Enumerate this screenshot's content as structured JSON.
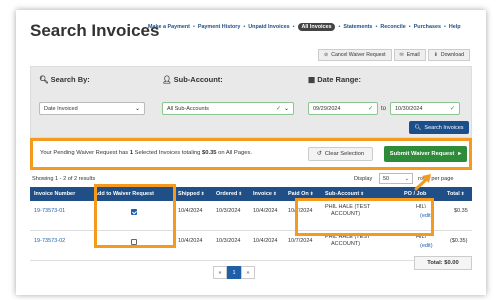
{
  "page": {
    "title": "Search Invoices"
  },
  "nav": {
    "items": [
      "Make a Payment",
      "Payment History",
      "Unpaid Invoices",
      "All Invoices",
      "Statements",
      "Reconcile",
      "Purchases",
      "Help"
    ],
    "active": "All Invoices"
  },
  "actions": {
    "cancel_waiver": "Cancel Waiver Request",
    "email": "Email",
    "download": "Download"
  },
  "filters": {
    "search_by_label": "Search By:",
    "search_by_value": "Date Invoiced",
    "sub_account_label": "Sub-Account:",
    "sub_account_value": "All Sub-Accounts",
    "date_range_label": "Date Range:",
    "date_from": "09/29/2024",
    "to_label": "to",
    "date_to": "10/30/2024",
    "search_button": "Search Invoices"
  },
  "pending": {
    "prefix": "Your Pending Waiver Request has ",
    "count": "1",
    "middle": " Selected Invoices totaling ",
    "amount": "$0.35",
    "suffix": " on All Pages.",
    "clear_button": "Clear Selection",
    "submit_button": "Submit Waiver Request"
  },
  "results": {
    "summary": "Showing 1 - 2 of 2 results",
    "display_label": "Display",
    "display_value": "50",
    "rows_per_page": "rows per page"
  },
  "table": {
    "headers": {
      "invoice_number": "Invoice Number",
      "add_to_waiver": "Add to Waiver Request",
      "shipped": "Shipped",
      "ordered": "Ordered",
      "invoice": "Invoice",
      "paid_on": "Paid On",
      "sub_account": "Sub-Account",
      "po_job": "PO / Job",
      "total": "Total"
    },
    "rows": [
      {
        "invoice_number": "19-73573-01",
        "checked": true,
        "shipped": "10/4/2024",
        "ordered": "10/3/2024",
        "invoice": "10/4/2024",
        "paid_on": "10/7/2024",
        "sub_account_1": "PHIL HALE (TEST",
        "sub_account_2": "ACCOUNT)",
        "po": "HIL\\",
        "edit": "(edit)",
        "total": "$0.35"
      },
      {
        "invoice_number": "19-73573-02",
        "checked": false,
        "shipped": "10/4/2024",
        "ordered": "10/3/2024",
        "invoice": "10/4/2024",
        "paid_on": "10/7/2024",
        "sub_account_1": "PHIL HALE (TEST",
        "sub_account_2": "ACCOUNT)",
        "po": "HIL\\",
        "edit": "(edit)",
        "total": "($0.35)"
      }
    ],
    "total_label": "Total: $0.00"
  },
  "pager": {
    "prev": "«",
    "current": "1",
    "next": "»"
  },
  "colors": {
    "primary": "#1f4f86",
    "submit": "#2e8b3a",
    "highlight": "#f39a1f"
  }
}
